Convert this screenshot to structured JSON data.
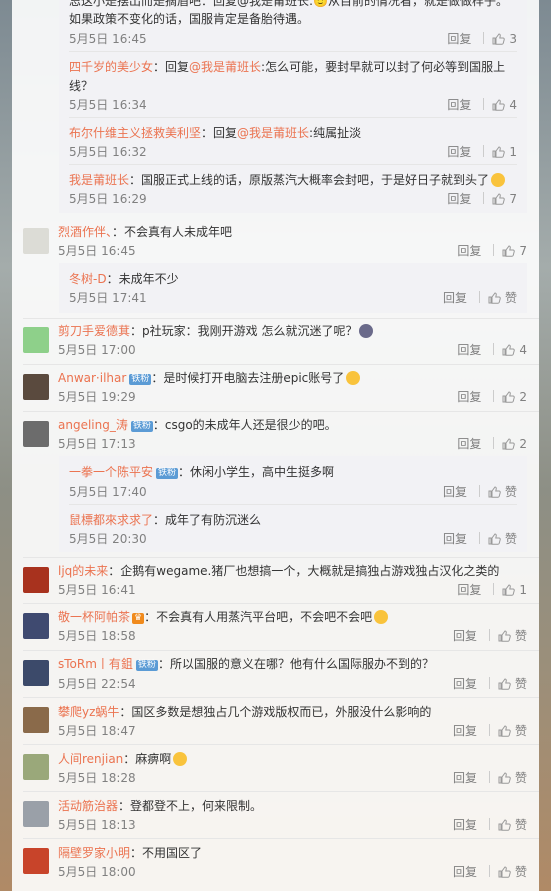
{
  "top_partial": {
    "text": "忌这小是摆出而是摘眉吧：回复@我是莆班长:🙂从目前的情况看，就是做做样子。"
  },
  "replies_block1": [
    {
      "user": "",
      "text": "如果政策不变化的话，国服肯定是备胎待遇。",
      "time": "5月5日 16:45",
      "reply": "回复",
      "likes": "3"
    },
    {
      "user": "四千岁的美少女",
      "text": "：回复@我是莆班长:怎么可能，要封早就可以封了何必等到国服上线？",
      "time": "5月5日 16:34",
      "reply": "回复",
      "likes": "4"
    },
    {
      "user": "布尔什维主义拯救美利坚",
      "text": "：回复@我是莆班长:纯属扯淡",
      "time": "5月5日 16:32",
      "reply": "回复",
      "likes": "1"
    },
    {
      "user": "我是莆班长",
      "text": "：国服正式上线的话，原版蒸汽大概率会封吧，于是好日子就到头了",
      "time": "5月5日 16:29",
      "reply": "回复",
      "likes": "7"
    }
  ],
  "comments": [
    {
      "user": "烈酒作伴、",
      "text": "：不会真有人未成年吧",
      "time": "5月5日 16:45",
      "reply": "回复",
      "likes": "7"
    },
    {
      "user": "冬树-D",
      "text": "：未成年不少",
      "time": "5月5日 17:41",
      "reply": "回复",
      "likes": "赞"
    },
    {
      "user": "剪刀手爱德萁",
      "text": "：p社玩家：我刚开游戏 怎么就沉迷了呢？",
      "time": "5月5日 17:00",
      "reply": "回复",
      "likes": "4"
    },
    {
      "user": "Anwar·ilhar",
      "badge": "铁粉",
      "text": "：是时候打开电脑去注册epic账号了",
      "time": "5月5日 19:29",
      "reply": "回复",
      "likes": "2"
    },
    {
      "user": "angeling_涛",
      "badge": "铁粉",
      "text": "：csgo的未成年人还是很少的吧。",
      "time": "5月5日 17:13",
      "reply": "回复",
      "likes": "2"
    },
    {
      "user": "一拳一个陈平安",
      "badge": "铁粉",
      "text": "：休闲小学生，高中生挺多啊",
      "time": "5月5日 17:40",
      "reply": "回复",
      "likes": "赞"
    },
    {
      "user": "鼠標都來求求了",
      "text": "：成年了有防沉迷么",
      "time": "5月5日 20:30",
      "reply": "回复",
      "likes": "赞"
    },
    {
      "user": "ljq的未来",
      "text": "：企鹅有wegame.猪厂也想搞一个，大概就是搞独占游戏独占汉化之类的",
      "time": "5月5日 16:41",
      "reply": "回复",
      "likes": "1"
    },
    {
      "user": "敬一杯阿帕茶",
      "badge": "",
      "text": "：不会真有人用蒸汽平台吧，不会吧不会吧",
      "time": "5月5日 18:58",
      "reply": "回复",
      "likes": "赞"
    },
    {
      "user": "sToRm丨有鉏",
      "badge": "铁粉",
      "text": "：所以国服的意义在哪？他有什么国际服办不到的？",
      "time": "5月5日 22:54",
      "reply": "回复",
      "likes": "赞"
    },
    {
      "user": "攀爬yz蜗牛",
      "text": "：国区多数是想独占几个游戏版权而已，外服没什么影响的",
      "time": "5月5日 18:47",
      "reply": "回复",
      "likes": "赞"
    },
    {
      "user": "人间renjian",
      "text": "：麻痹啊",
      "time": "5月5日 18:28",
      "reply": "回复",
      "likes": "赞"
    },
    {
      "user": "活动筋治器",
      "text": "：登都登不上，何来限制。",
      "time": "5月5日 18:13",
      "reply": "回复",
      "likes": "赞"
    },
    {
      "user": "隔壁罗家小明",
      "text": "：不用国区了",
      "time": "5月5日 18:00",
      "reply": "回复",
      "likes": "赞"
    }
  ],
  "colors": {
    "username": "#eb7350",
    "meta": "#808080",
    "badge": "#5b9bd5"
  }
}
